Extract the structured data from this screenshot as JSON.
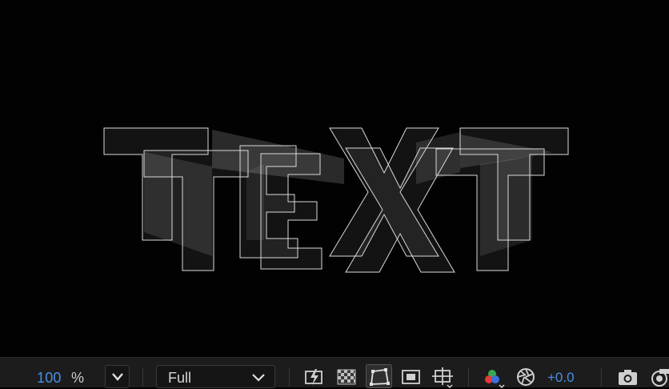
{
  "viewer": {
    "text_content": "TEXT"
  },
  "toolbar": {
    "zoom_value": "100",
    "zoom_unit": "%",
    "resolution": "Full",
    "exposure": "+0.0",
    "icons": [
      "zoom-dropdown-icon",
      "fast-previews-icon",
      "transparency-grid-icon",
      "mask-path-visibility-icon",
      "region-of-interest-icon",
      "grid-guides-icon",
      "show-channel-icon",
      "reset-exposure-icon",
      "snapshot-camera-icon",
      "show-snapshot-icon"
    ]
  }
}
